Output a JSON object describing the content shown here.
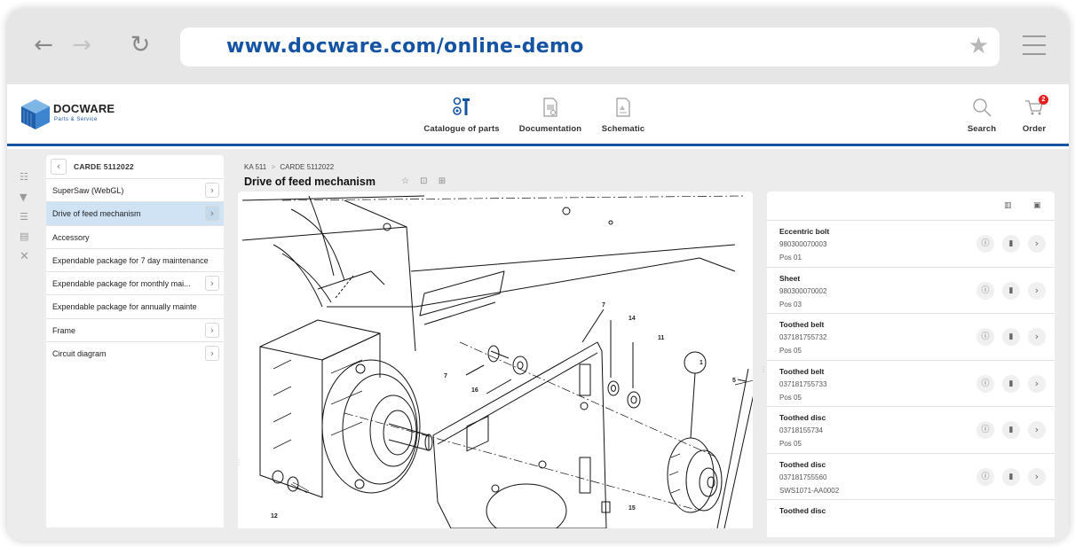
{
  "browser": {
    "url": "www.docware.com/online-demo"
  },
  "header": {
    "logo_text": "DOCWARE",
    "logo_sub": "Parts & Service",
    "nav": [
      {
        "label": "Catalogue of parts"
      },
      {
        "label": "Documentation"
      },
      {
        "label": "Schematic"
      }
    ],
    "search_label": "Search",
    "order_label": "Order",
    "order_badge": "2"
  },
  "colors": {
    "accent": "#1553a3",
    "badge": "#e32222",
    "active_row": "#cfe3f5"
  },
  "tree": {
    "title": "CARDE 5112022",
    "items": [
      {
        "label": "SuperSaw (WebGL)",
        "has_children": true
      },
      {
        "label": "Drive of feed mechanism",
        "has_children": true,
        "active": true
      },
      {
        "label": "Accessory",
        "has_children": false
      },
      {
        "label": "Expendable package for 7 day maintenance",
        "has_children": false
      },
      {
        "label": "Expendable package for monthly mai...",
        "has_children": true
      },
      {
        "label": "Expendable package for annually mainte",
        "has_children": false
      },
      {
        "label": "Frame",
        "has_children": true
      },
      {
        "label": "Circuit diagram",
        "has_children": true
      }
    ]
  },
  "breadcrumb": {
    "root": "KA 511",
    "separator": ">",
    "current": "CARDE 5112022"
  },
  "page": {
    "title": "Drive of feed mechanism"
  },
  "drawing": {
    "callouts": [
      "7",
      "14",
      "11",
      "1",
      "5",
      "7",
      "16",
      "12",
      "15"
    ]
  },
  "parts": [
    {
      "name": "Eccentric bolt",
      "number": "980300070003",
      "pos": "Pos 01"
    },
    {
      "name": "Sheet",
      "number": "980300070002",
      "pos": "Pos 03"
    },
    {
      "name": "Toothed belt",
      "number": "037181755732",
      "pos": "Pos 05"
    },
    {
      "name": "Toothed belt",
      "number": "037181755733",
      "pos": "Pos 05"
    },
    {
      "name": "Toothed disc",
      "number": "03718155734",
      "pos": "Pos 05"
    },
    {
      "name": "Toothed disc",
      "number": "037181755560",
      "pos": "SWS1071-AA0002"
    },
    {
      "name": "Toothed disc",
      "number": "",
      "pos": ""
    }
  ]
}
